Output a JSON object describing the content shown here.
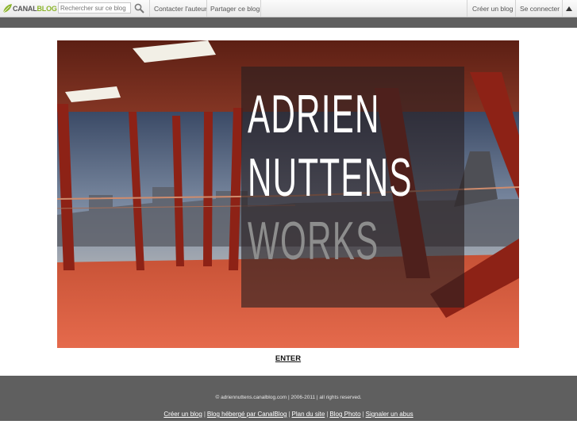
{
  "toolbar": {
    "brand_prefix": "CANAL",
    "brand_suffix": "BLOG",
    "search_placeholder": "Rechercher sur ce blog",
    "contact_label": "Contacter l'auteur",
    "share_label": "Partager ce blog",
    "create_label": "Créer un blog",
    "login_label": "Se connecter",
    "collapse_icon": "triangle-up-icon"
  },
  "hero": {
    "title_line_1": "ADRIEN",
    "title_line_2": "NUTTENS",
    "title_line_3": "WORKS"
  },
  "enter_label": "ENTER",
  "footer": {
    "copyright": "© adriennuttens.canalblog.com | 2006-2011 | all rights reserved.",
    "links": [
      "Créer un blog",
      "Blog hébergé par CanalBlog",
      "Plan du site",
      "Blog Photo",
      "Signaler un abus"
    ]
  }
}
